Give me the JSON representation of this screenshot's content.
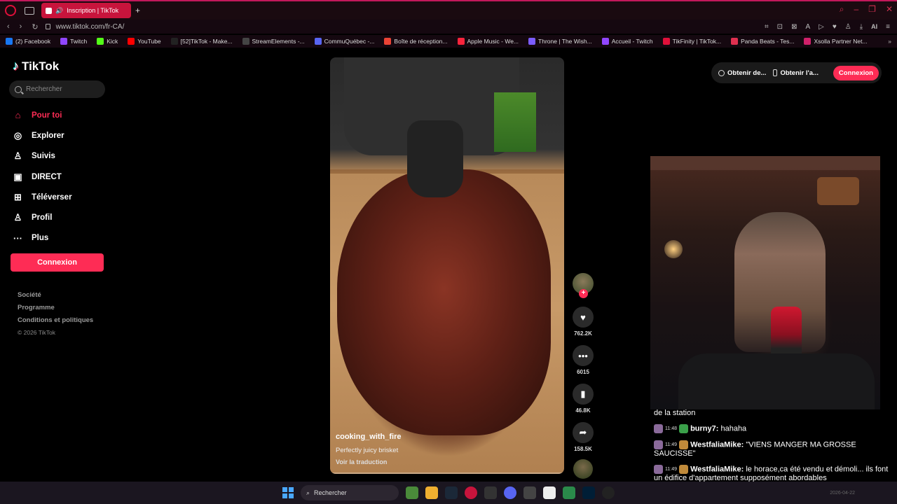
{
  "browser": {
    "tab_title": "Inscription | TikTok",
    "url": "www.tiktok.com/fr-CA/",
    "bookmarks": [
      {
        "label": "(2) Facebook",
        "color": "#1877f2"
      },
      {
        "label": "Twitch",
        "color": "#9146ff"
      },
      {
        "label": "Kick",
        "color": "#53fc18"
      },
      {
        "label": "YouTube",
        "color": "#ff0000"
      },
      {
        "label": "[52]TikTok - Make...",
        "color": "#222222"
      },
      {
        "label": "StreamElements -...",
        "color": "#444444"
      },
      {
        "label": "CommuQuébec -...",
        "color": "#5865f2"
      },
      {
        "label": "Boîte de réception...",
        "color": "#ea4335"
      },
      {
        "label": "Apple Music - We...",
        "color": "#fa243c"
      },
      {
        "label": "Throne | The Wish...",
        "color": "#7b5cff"
      },
      {
        "label": "Accueil - Twitch",
        "color": "#9146ff"
      },
      {
        "label": "TikFinity | TikTok...",
        "color": "#e0103a"
      },
      {
        "label": "Panda Beats - Tes...",
        "color": "#e03050"
      },
      {
        "label": "Xsolla Partner Net...",
        "color": "#d0206a"
      }
    ],
    "ai_label": "AI"
  },
  "sidebar": {
    "logo": "TikTok",
    "search_placeholder": "Rechercher",
    "items": [
      {
        "label": "Pour toi",
        "icon": "home-icon",
        "glyph": "⌂"
      },
      {
        "label": "Explorer",
        "icon": "compass-icon",
        "glyph": "◎"
      },
      {
        "label": "Suivis",
        "icon": "user-follow-icon",
        "glyph": "♙"
      },
      {
        "label": "DIRECT",
        "icon": "live-icon",
        "glyph": "▣"
      },
      {
        "label": "Téléverser",
        "icon": "upload-icon",
        "glyph": "⊞"
      },
      {
        "label": "Profil",
        "icon": "profile-icon",
        "glyph": "♙"
      },
      {
        "label": "Plus",
        "icon": "more-icon",
        "glyph": "···"
      }
    ],
    "login_button": "Connexion",
    "footer": {
      "links": [
        "Société",
        "Programme",
        "Conditions et politiques"
      ],
      "copyright": "© 2026 TikTok"
    }
  },
  "video": {
    "author": "cooking_with_fire",
    "description": "Perfectly juicy brisket",
    "translate_link": "Voir la traduction",
    "likes": "762.2K",
    "comments": "6015",
    "saves": "46.8K",
    "shares": "158.5K"
  },
  "topbar": {
    "get_coins": "Obtenir de...",
    "get_app": "Obtenir l'a...",
    "login": "Connexion"
  },
  "chat": {
    "partial_line": "de la station",
    "messages": [
      {
        "time": "11:48",
        "user": "burny7:",
        "text": "hahaha"
      },
      {
        "time": "11:49",
        "user": "WestfaliaMike:",
        "text": "\"VIENS MANGER MA GROSSE SAUCISSE\""
      },
      {
        "time": "11:49",
        "user": "WestfaliaMike:",
        "text": "le horace,ca été vendu et démoli... ils font un édifice d'appartement supposément abordables"
      }
    ]
  },
  "taskbar": {
    "search_placeholder": "Rechercher",
    "tray_date": "2026-04-22"
  },
  "colors": {
    "accent": "#fe2c55",
    "browser_accent": "#c8143c"
  }
}
